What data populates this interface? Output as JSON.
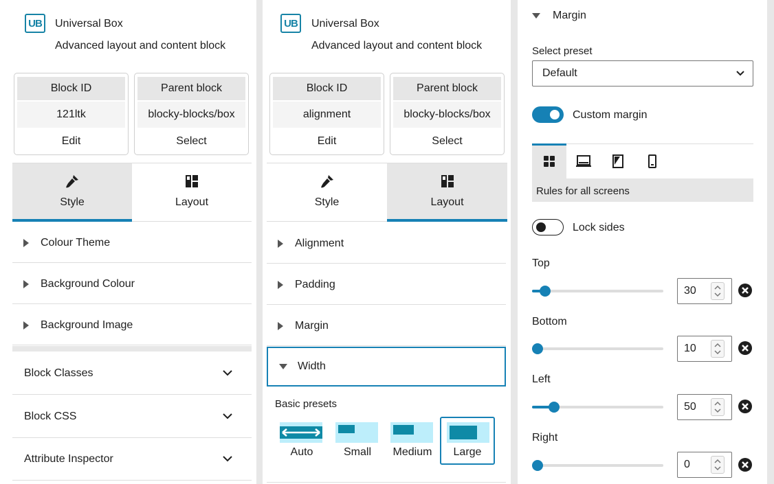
{
  "block": {
    "logo_text": "UB",
    "title": "Universal Box",
    "description": "Advanced layout and content block"
  },
  "left_panel": {
    "cards": [
      {
        "head": "Block ID",
        "value": "121ltk",
        "action": "Edit"
      },
      {
        "head": "Parent block",
        "value": "blocky-blocks/box",
        "action": "Select"
      }
    ],
    "tabs": [
      {
        "label": "Style"
      },
      {
        "label": "Layout"
      }
    ],
    "rows": [
      {
        "label": "Colour Theme"
      },
      {
        "label": "Background Colour"
      },
      {
        "label": "Background Image"
      }
    ],
    "accordions": [
      {
        "label": "Block Classes"
      },
      {
        "label": "Block CSS"
      },
      {
        "label": "Attribute Inspector"
      }
    ]
  },
  "middle_panel": {
    "cards": [
      {
        "head": "Block ID",
        "value": "alignment",
        "action": "Edit"
      },
      {
        "head": "Parent block",
        "value": "blocky-blocks/box",
        "action": "Select"
      }
    ],
    "tabs": [
      {
        "label": "Style"
      },
      {
        "label": "Layout"
      }
    ],
    "rows": [
      {
        "label": "Alignment"
      },
      {
        "label": "Padding"
      },
      {
        "label": "Margin"
      }
    ],
    "open_row": {
      "label": "Width"
    },
    "presets_label": "Basic presets",
    "presets": [
      {
        "label": "Auto",
        "fraction": 1.0
      },
      {
        "label": "Small",
        "fraction": 0.4
      },
      {
        "label": "Medium",
        "fraction": 0.5
      },
      {
        "label": "Large",
        "fraction": 0.66,
        "selected": true
      }
    ]
  },
  "right_panel": {
    "section_title": "Margin",
    "preset_label": "Select preset",
    "preset_value": "Default",
    "custom_margin_label": "Custom margin",
    "custom_margin_on": true,
    "screen_tabs": [
      "all-screens",
      "desktop",
      "tablet",
      "mobile"
    ],
    "screen_caption": "Rules for all screens",
    "lock_sides_label": "Lock sides",
    "lock_sides_on": false,
    "sliders": [
      {
        "label": "Top",
        "value": "30",
        "level": 0.1
      },
      {
        "label": "Bottom",
        "value": "10",
        "level": 0.03
      },
      {
        "label": "Left",
        "value": "50",
        "level": 0.17
      },
      {
        "label": "Right",
        "value": "0",
        "level": 0.0
      }
    ]
  },
  "colors": {
    "accent": "#1681b5",
    "logo": "#1683a6",
    "preset_thumb": "#bdeefb",
    "preset_bar": "#0f8aa6"
  }
}
